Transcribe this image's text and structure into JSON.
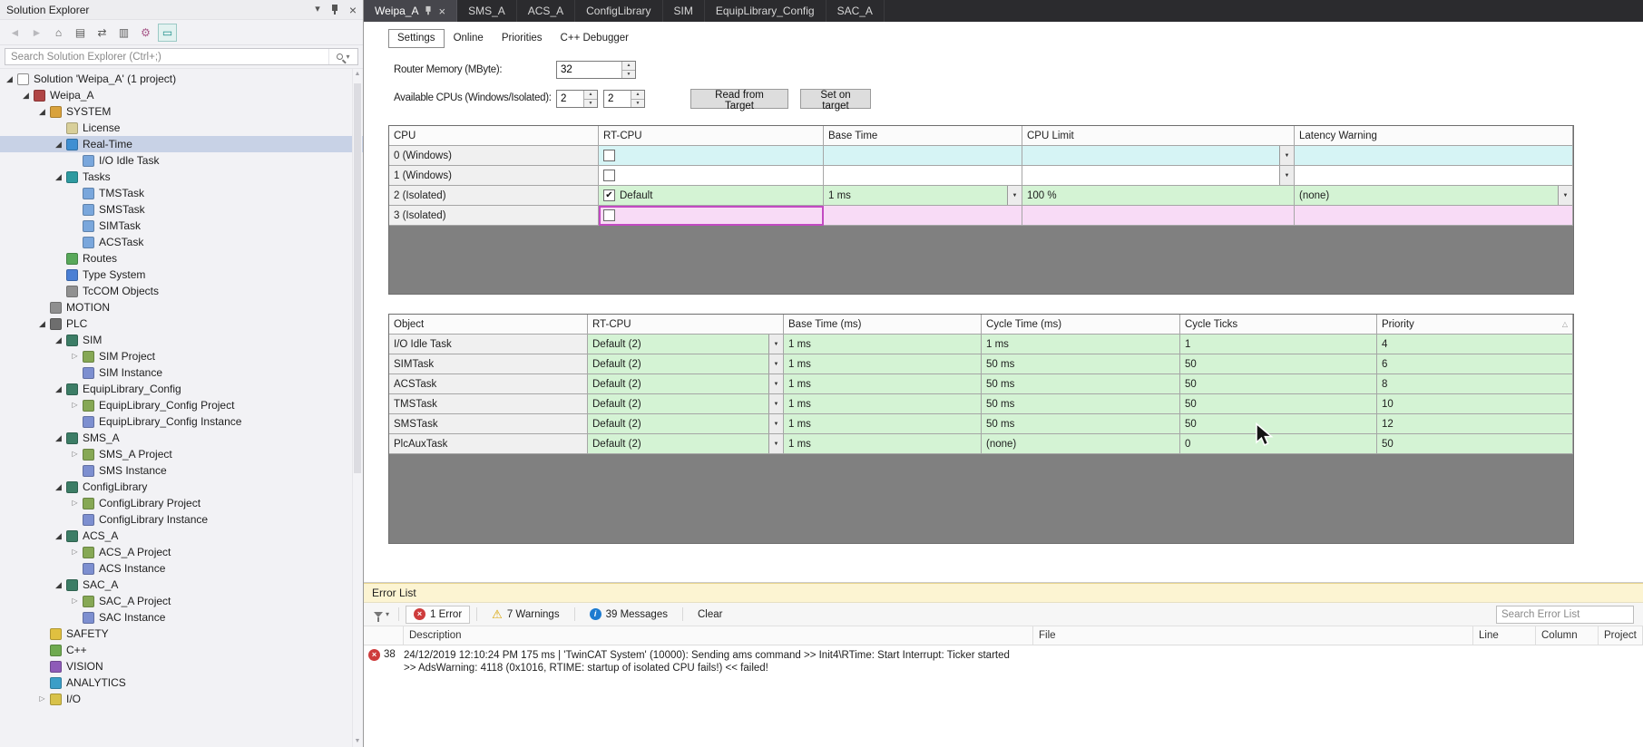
{
  "colors": {
    "selection": "#c8d2e6",
    "row_cyan": "#d6f4f5",
    "row_green": "#d4f3d4",
    "row_pink": "#f8dbf6",
    "error_red": "#ce3c3c",
    "info_blue": "#1d7bd0",
    "tabstrip_bg": "#2b2b2e",
    "active_tab_bg": "#46464c",
    "errorlist_header_bg": "#fcf4d2"
  },
  "solution_explorer": {
    "title": "Solution Explorer",
    "search_placeholder": "Search Solution Explorer (Ctrl+;)",
    "toolbar_icons": [
      {
        "name": "back-icon",
        "glyph": "◄",
        "style": "disabled"
      },
      {
        "name": "forward-icon",
        "glyph": "►",
        "style": "disabled"
      },
      {
        "name": "home-icon",
        "glyph": "⌂",
        "style": "normal"
      },
      {
        "name": "collapse-all-icon",
        "glyph": "▤",
        "style": "normal"
      },
      {
        "name": "sync-with-active-document-icon",
        "glyph": "⇄",
        "style": "normal"
      },
      {
        "name": "show-all-files-icon",
        "glyph": "▥",
        "style": "normal"
      },
      {
        "name": "properties-icon",
        "glyph": "⚙",
        "style": "colored"
      },
      {
        "name": "preview-selected-items-icon",
        "glyph": "▭",
        "style": "teal"
      }
    ],
    "tree": [
      {
        "label": "Solution 'Weipa_A' (1 project)",
        "level": 0,
        "icon": "solution",
        "arrow": "expanded"
      },
      {
        "label": "Weipa_A",
        "level": 1,
        "icon": "project",
        "arrow": "expanded"
      },
      {
        "label": "SYSTEM",
        "level": 2,
        "icon": "system",
        "arrow": "expanded"
      },
      {
        "label": "License",
        "level": 3,
        "icon": "license",
        "arrow": "none"
      },
      {
        "label": "Real-Time",
        "level": 3,
        "icon": "realtime",
        "arrow": "expanded",
        "selected": true
      },
      {
        "label": "I/O Idle Task",
        "level": 4,
        "icon": "task",
        "arrow": "none"
      },
      {
        "label": "Tasks",
        "level": 3,
        "icon": "tasks",
        "arrow": "expanded"
      },
      {
        "label": "TMSTask",
        "level": 4,
        "icon": "task",
        "arrow": "none"
      },
      {
        "label": "SMSTask",
        "level": 4,
        "icon": "task",
        "arrow": "none"
      },
      {
        "label": "SIMTask",
        "level": 4,
        "icon": "task",
        "arrow": "none"
      },
      {
        "label": "ACSTask",
        "level": 4,
        "icon": "task",
        "arrow": "none"
      },
      {
        "label": "Routes",
        "level": 3,
        "icon": "routes",
        "arrow": "none"
      },
      {
        "label": "Type System",
        "level": 3,
        "icon": "typesystem",
        "arrow": "none"
      },
      {
        "label": "TcCOM Objects",
        "level": 3,
        "icon": "tccom",
        "arrow": "none"
      },
      {
        "label": "MOTION",
        "level": 2,
        "icon": "motion",
        "arrow": "none"
      },
      {
        "label": "PLC",
        "level": 2,
        "icon": "plc",
        "arrow": "expanded"
      },
      {
        "label": "SIM",
        "level": 3,
        "icon": "plcnode",
        "arrow": "expanded"
      },
      {
        "label": "SIM Project",
        "level": 4,
        "icon": "plcproject",
        "arrow": "collapsed"
      },
      {
        "label": "SIM Instance",
        "level": 4,
        "icon": "instance",
        "arrow": "none"
      },
      {
        "label": "EquipLibrary_Config",
        "level": 3,
        "icon": "plcnode",
        "arrow": "expanded"
      },
      {
        "label": "EquipLibrary_Config Project",
        "level": 4,
        "icon": "plcproject",
        "arrow": "collapsed"
      },
      {
        "label": "EquipLibrary_Config Instance",
        "level": 4,
        "icon": "instance",
        "arrow": "none"
      },
      {
        "label": "SMS_A",
        "level": 3,
        "icon": "plcnode",
        "arrow": "expanded"
      },
      {
        "label": "SMS_A Project",
        "level": 4,
        "icon": "plcproject",
        "arrow": "collapsed"
      },
      {
        "label": "SMS Instance",
        "level": 4,
        "icon": "instance",
        "arrow": "none"
      },
      {
        "label": "ConfigLibrary",
        "level": 3,
        "icon": "plcnode",
        "arrow": "expanded"
      },
      {
        "label": "ConfigLibrary Project",
        "level": 4,
        "icon": "plcproject",
        "arrow": "collapsed"
      },
      {
        "label": "ConfigLibrary Instance",
        "level": 4,
        "icon": "instance",
        "arrow": "none"
      },
      {
        "label": "ACS_A",
        "level": 3,
        "icon": "plcnode",
        "arrow": "expanded"
      },
      {
        "label": "ACS_A Project",
        "level": 4,
        "icon": "plcproject",
        "arrow": "collapsed"
      },
      {
        "label": "ACS Instance",
        "level": 4,
        "icon": "instance",
        "arrow": "none"
      },
      {
        "label": "SAC_A",
        "level": 3,
        "icon": "plcnode",
        "arrow": "expanded"
      },
      {
        "label": "SAC_A Project",
        "level": 4,
        "icon": "plcproject",
        "arrow": "collapsed"
      },
      {
        "label": "SAC Instance",
        "level": 4,
        "icon": "instance",
        "arrow": "none"
      },
      {
        "label": "SAFETY",
        "level": 2,
        "icon": "safety",
        "arrow": "none"
      },
      {
        "label": "C++",
        "level": 2,
        "icon": "cpp",
        "arrow": "none"
      },
      {
        "label": "VISION",
        "level": 2,
        "icon": "vision",
        "arrow": "none"
      },
      {
        "label": "ANALYTICS",
        "level": 2,
        "icon": "analytics",
        "arrow": "none"
      },
      {
        "label": "I/O",
        "level": 2,
        "icon": "io",
        "arrow": "collapsed"
      }
    ]
  },
  "document_tabs": [
    {
      "label": "Weipa_A",
      "active": true
    },
    {
      "label": "SMS_A",
      "active": false
    },
    {
      "label": "ACS_A",
      "active": false
    },
    {
      "label": "ConfigLibrary",
      "active": false
    },
    {
      "label": "SIM",
      "active": false
    },
    {
      "label": "EquipLibrary_Config",
      "active": false
    },
    {
      "label": "SAC_A",
      "active": false
    }
  ],
  "editor": {
    "tabs": [
      {
        "label": "Settings",
        "active": true
      },
      {
        "label": "Online",
        "active": false
      },
      {
        "label": "Priorities",
        "active": false
      },
      {
        "label": "C++ Debugger",
        "active": false
      }
    ],
    "router_memory_label": "Router Memory (MByte):",
    "router_memory_value": "32",
    "available_cpus_label": "Available CPUs (Windows/Isolated):",
    "cpus_windows": "2",
    "cpus_isolated": "2",
    "read_from_target_button": "Read from Target",
    "set_on_target_button": "Set on target",
    "cpu_table": {
      "columns": [
        "CPU",
        "RT-CPU",
        "Base Time",
        "CPU Limit",
        "Latency Warning"
      ],
      "rows": [
        {
          "cpu": "0 (Windows)",
          "checked": false,
          "rt": "",
          "base_time": "",
          "base_dd": false,
          "cpu_limit": "",
          "limit_dd": true,
          "latency": "",
          "lat_dd": false,
          "tint": "cyan",
          "focus": false
        },
        {
          "cpu": "1 (Windows)",
          "checked": false,
          "rt": "",
          "base_time": "",
          "base_dd": false,
          "cpu_limit": "",
          "limit_dd": true,
          "latency": "",
          "lat_dd": false,
          "tint": "white",
          "focus": false
        },
        {
          "cpu": "2 (Isolated)",
          "checked": true,
          "rt": "Default",
          "base_time": "1 ms",
          "base_dd": true,
          "cpu_limit": "100 %",
          "limit_dd": false,
          "latency": "(none)",
          "lat_dd": true,
          "tint": "green",
          "focus": false
        },
        {
          "cpu": "3 (Isolated)",
          "checked": false,
          "rt": "",
          "base_time": "",
          "base_dd": false,
          "cpu_limit": "",
          "limit_dd": false,
          "latency": "",
          "lat_dd": false,
          "tint": "pink",
          "focus": true
        }
      ]
    },
    "task_table": {
      "columns": [
        "Object",
        "RT-CPU",
        "Base Time (ms)",
        "Cycle Time (ms)",
        "Cycle Ticks",
        "Priority"
      ],
      "sort_column": "Priority",
      "rows": [
        {
          "object": "I/O Idle Task",
          "rt_cpu": "Default (2)",
          "base_time": "1 ms",
          "cycle_time": "1 ms",
          "cycle_ticks": "1",
          "priority": "4"
        },
        {
          "object": "SIMTask",
          "rt_cpu": "Default (2)",
          "base_time": "1 ms",
          "cycle_time": "50 ms",
          "cycle_ticks": "50",
          "priority": "6"
        },
        {
          "object": "ACSTask",
          "rt_cpu": "Default (2)",
          "base_time": "1 ms",
          "cycle_time": "50 ms",
          "cycle_ticks": "50",
          "priority": "8"
        },
        {
          "object": "TMSTask",
          "rt_cpu": "Default (2)",
          "base_time": "1 ms",
          "cycle_time": "50 ms",
          "cycle_ticks": "50",
          "priority": "10"
        },
        {
          "object": "SMSTask",
          "rt_cpu": "Default (2)",
          "base_time": "1 ms",
          "cycle_time": "50 ms",
          "cycle_ticks": "50",
          "priority": "12"
        },
        {
          "object": "PlcAuxTask",
          "rt_cpu": "Default (2)",
          "base_time": "1 ms",
          "cycle_time": "(none)",
          "cycle_ticks": "0",
          "priority": "50"
        }
      ]
    }
  },
  "error_list": {
    "title": "Error List",
    "error_count_label": "1 Error",
    "warning_count_label": "7 Warnings",
    "message_count_label": "39 Messages",
    "clear_label": "Clear",
    "search_placeholder": "Search Error List",
    "columns": [
      "Description",
      "File",
      "Line",
      "Column",
      "Project"
    ],
    "entries": [
      {
        "number": "38",
        "line1": "24/12/2019 12:10:24 PM 175 ms | 'TwinCAT System' (10000): Sending ams command >> Init4\\RTime: Start Interrupt: Ticker started",
        "line2": ">> AdsWarning: 4118 (0x1016, RTIME: startup of isolated CPU fails!) << failed!"
      }
    ]
  }
}
